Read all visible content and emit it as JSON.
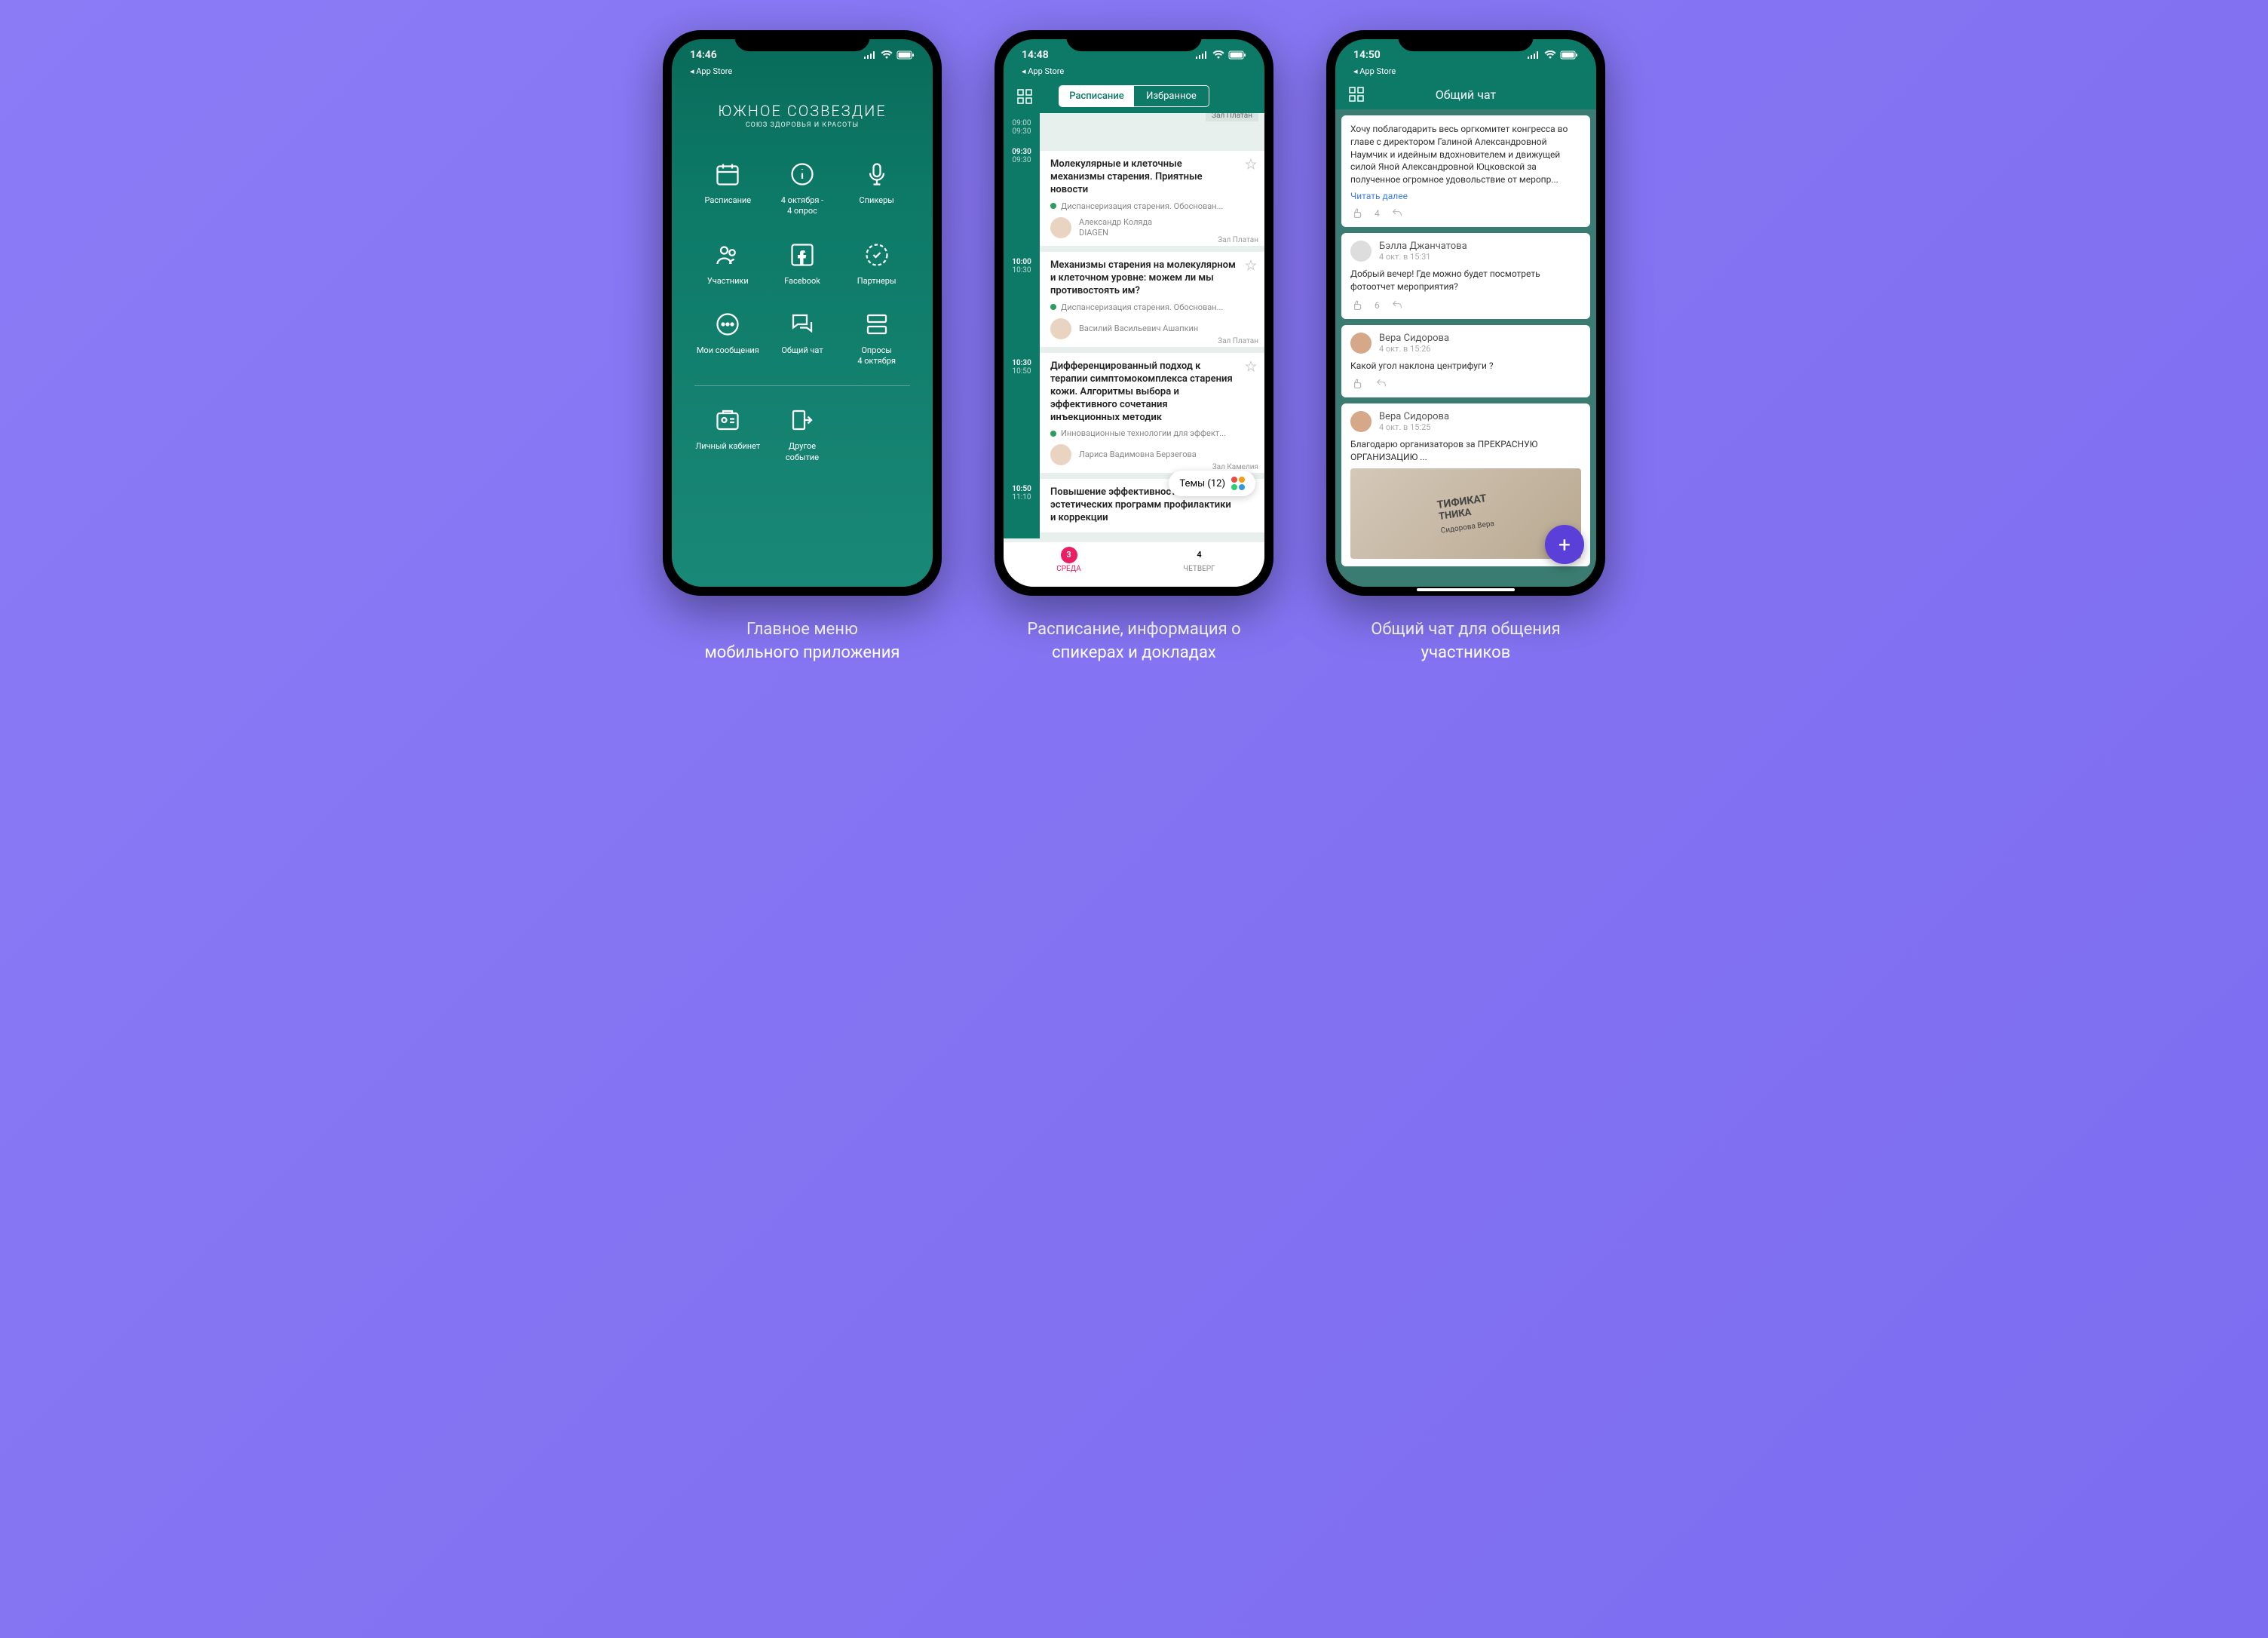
{
  "captions": {
    "phone1": "Главное меню\nмобильного приложения",
    "phone2": "Расписание, информация о\nспикерах и докладах",
    "phone3": "Общий чат для общения\nучастников"
  },
  "status": {
    "time1": "14:46",
    "time2": "14:48",
    "time3": "14:50",
    "back": "◂ App Store"
  },
  "logo": {
    "title": "ЮЖНОЕ СОЗВЕЗДИЕ",
    "subtitle": "СОЮЗ ЗДОРОВЬЯ И КРАСОТЫ"
  },
  "menu": [
    {
      "label": "Расписание",
      "icon": "calendar"
    },
    {
      "label": "4 октября -\n4 опрос",
      "icon": "info"
    },
    {
      "label": "Спикеры",
      "icon": "mic"
    },
    {
      "label": "Участники",
      "icon": "people"
    },
    {
      "label": "Facebook",
      "icon": "facebook"
    },
    {
      "label": "Партнеры",
      "icon": "badge"
    },
    {
      "label": "Мои сообщения",
      "icon": "chat"
    },
    {
      "label": "Общий чат",
      "icon": "chats"
    },
    {
      "label": "Опросы\n4 октября",
      "icon": "poll"
    },
    {
      "label": "Личный кабинет",
      "icon": "profile"
    },
    {
      "label": "Другое\nсобытие",
      "icon": "exit"
    }
  ],
  "schedule": {
    "tabs": {
      "active": "Расписание",
      "inactive": "Избранное"
    },
    "hall_top": "Зал Платан",
    "items": [
      {
        "time1": "09:30",
        "time2": "09:30",
        "title": "Молекулярные и клеточные механизмы старения. Приятные новости",
        "track": "Диспансеризация старения. Обоснован...",
        "speaker": "Александр Коляда",
        "org": "DIAGEN",
        "hall": "Зал Платан"
      },
      {
        "time1": "10:00",
        "time2": "10:30",
        "title": "Механизмы старения на молекулярном и клеточном уровне: можем ли мы противостоять им?",
        "track": "Диспансеризация старения. Обоснован...",
        "speaker": "Василий Васильевич Ашапкин",
        "org": "",
        "hall": "Зал Платан"
      },
      {
        "time1": "10:30",
        "time2": "10:50",
        "title": "Дифференцированный подход к терапии симптомокомплекса старения кожи. Алгоритмы выбора и эффективного сочетания инъекционных методик",
        "track": "Инновационные технологии для эффект...",
        "speaker": "Лариса Вадимовна Берзегова",
        "org": "",
        "hall": "Зал Камелия"
      },
      {
        "time1": "10:50",
        "time2": "11:10",
        "title": "Повышение эффективности эстетических программ профилактики и коррекции",
        "track": "",
        "speaker": "",
        "org": "",
        "hall": ""
      }
    ],
    "themes_label": "Темы (12)",
    "days": [
      {
        "num": "3",
        "name": "СРЕДА",
        "active": true
      },
      {
        "num": "4",
        "name": "ЧЕТВЕРГ",
        "active": false
      }
    ]
  },
  "chat": {
    "title": "Общий чат",
    "messages": [
      {
        "text": "Хочу поблагодарить весь оргкомитет конгресса во главе с директором Галиной Александровной Наумчик и идейным вдохновителем и движущей силой Яной Александровной Юцковской за полученное огромное удовольствие от меропр...",
        "read_more": "Читать далее",
        "likes": "4"
      },
      {
        "author": "Бэлла Джанчатова",
        "time": "4 окт. в 15:31",
        "text": "Добрый вечер! Где можно будет посмотреть фотоотчет мероприятия?",
        "likes": "6"
      },
      {
        "author": "Вера Сидорова",
        "time": "4 окт. в 15:26",
        "text": "Какой угол наклона центрифуги ?",
        "likes": ""
      },
      {
        "author": "Вера Сидорова",
        "time": "4 окт. в 15:25",
        "text": "Благодарю организаторов за ПРЕКРАСНУЮ ОРГАНИЗАЦИЮ ...",
        "cert_line1": "ТИФИКАТ",
        "cert_line2": "ТНИКА",
        "cert_name": "Сидорова Вера"
      }
    ]
  }
}
